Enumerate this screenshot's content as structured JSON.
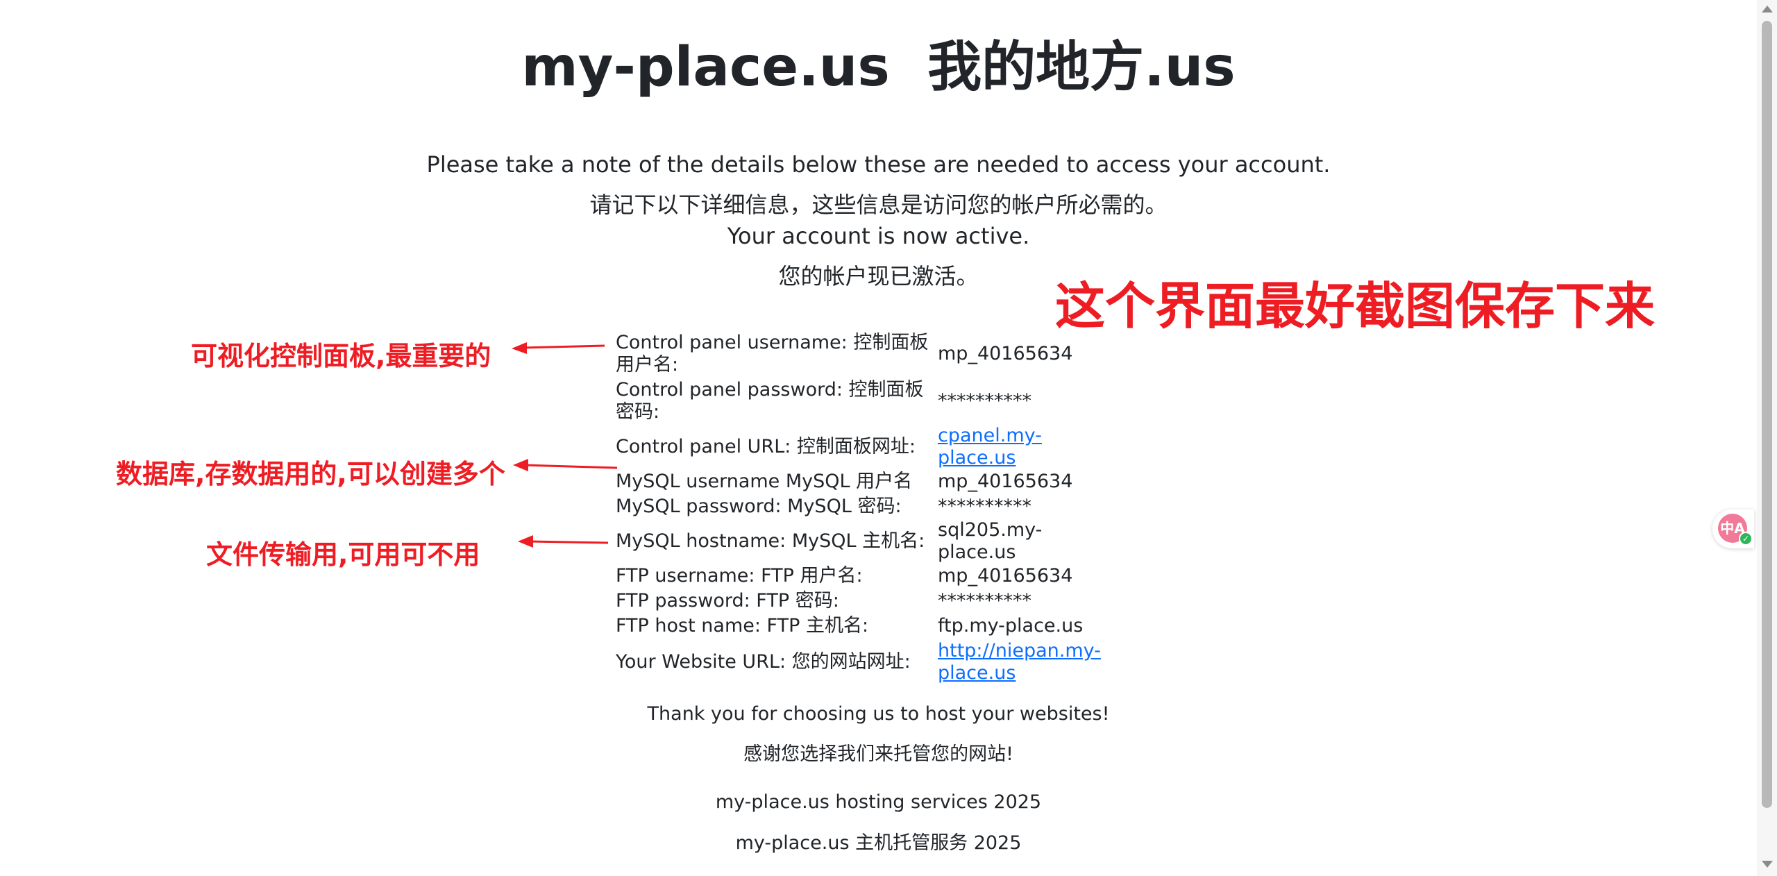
{
  "header": {
    "site_name": "my-place.us",
    "site_name_cn": "我的地方.us"
  },
  "intro": {
    "line1": "Please take a note of the details below these are needed to access your account.",
    "line2": "请记下以下详细信息，这些信息是访问您的帐户所必需的。",
    "line3": "Your account is now active.",
    "line4": "您的帐户现已激活。"
  },
  "details": [
    {
      "label": "Control panel username:  控制面板用户名:",
      "value": "mp_40165634"
    },
    {
      "label": "Control panel password:  控制面板密码:",
      "value": "**********"
    },
    {
      "label": "Control panel URL:  控制面板网址:",
      "value": "cpanel.my-place.us"
    },
    {
      "label": "MySQL username  MySQL 用户名",
      "value": "mp_40165634"
    },
    {
      "label": "MySQL password:  MySQL 密码:",
      "value": "**********"
    },
    {
      "label": "MySQL hostname:  MySQL 主机名:",
      "value": "sql205.my-place.us"
    },
    {
      "label": "FTP username:  FTP 用户名:",
      "value": "mp_40165634"
    },
    {
      "label": "FTP password:  FTP 密码:",
      "value": "**********"
    },
    {
      "label": "FTP host name:  FTP 主机名:",
      "value": "ftp.my-place.us"
    },
    {
      "label": "Your Website URL:  您的网站网址:",
      "value": "http://niepan.my-place.us"
    }
  ],
  "footer": {
    "thanks": "Thank you for choosing us to host your websites!",
    "thanks_cn": "感谢您选择我们来托管您的网站!",
    "copyright": "my-place.us hosting services 2025",
    "copyright_cn": "my-place.us 主机托管服务 2025"
  },
  "annotations": {
    "screenshot_note": "这个界面最好截图保存下来",
    "control_panel_note": "可视化控制面板,最重要的",
    "mysql_note": "数据库,存数据用的,可以创建多个",
    "ftp_note": "文件传输用,可用可不用"
  },
  "translate_widget": {
    "icon": "translate-icon",
    "badge_text": "中A"
  },
  "colors": {
    "annotation": "#ee1d24",
    "link": "#0d6efd",
    "text": "#212529"
  }
}
